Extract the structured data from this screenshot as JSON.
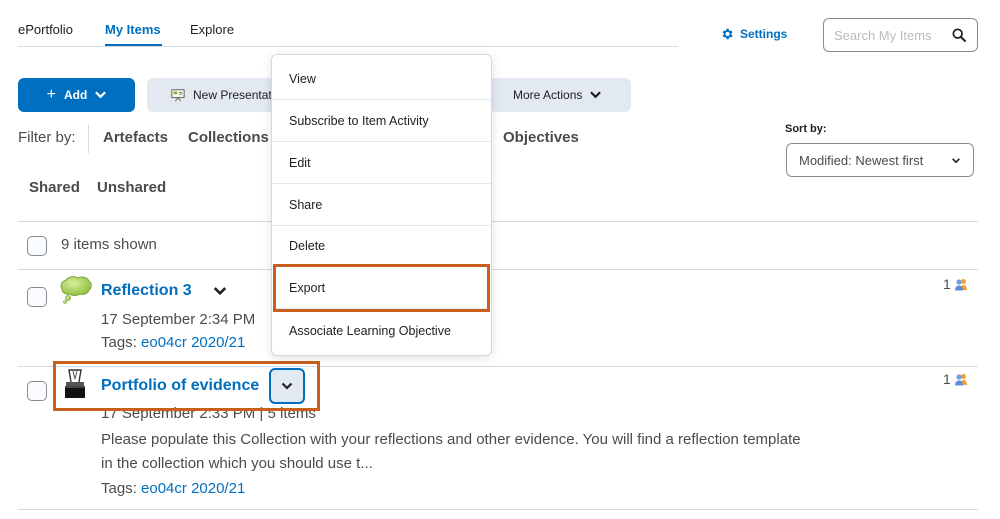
{
  "nav": {
    "tabs": [
      {
        "label": "ePortfolio",
        "active": false
      },
      {
        "label": "My Items",
        "active": true
      },
      {
        "label": "Explore",
        "active": false
      }
    ],
    "settings_label": "Settings",
    "search_placeholder": "Search My Items"
  },
  "toolbar": {
    "add_label": "Add",
    "new_presentation_label": "New Presentat",
    "more_actions_label": "More Actions"
  },
  "filters": {
    "label": "Filter by:",
    "row1": [
      "Artefacts",
      "Collections",
      "Objectives"
    ],
    "row2": [
      "Shared",
      "Unshared"
    ]
  },
  "sort": {
    "label": "Sort by:",
    "selected": "Modified: Newest first"
  },
  "list": {
    "items_shown": "9 items shown",
    "items": [
      {
        "title": "Reflection 3",
        "icon": "reflection-speech-bubble-icon",
        "meta": "17 September 2:34 PM",
        "tags_label": "Tags:",
        "tags": "eo04cr 2020/21",
        "share_count": "1"
      },
      {
        "title": "Portfolio of evidence",
        "icon": "binder-clip-collection-icon",
        "meta": "17 September 2:33 PM | 5 items",
        "description_line1": "Please populate this Collection with your reflections and other evidence. You will find a reflection template",
        "description_line2": "in the collection which you should use t...",
        "tags_label": "Tags:",
        "tags": "eo04cr 2020/21",
        "share_count": "1"
      }
    ]
  },
  "context_menu": {
    "items": [
      "View",
      "Subscribe to Item Activity",
      "Edit",
      "Share",
      "Delete",
      "Export",
      "Associate Learning Objective"
    ],
    "highlighted": "Export"
  },
  "colors": {
    "accent": "#006fbf",
    "highlight_box": "#c8601c",
    "button_grey": "#e3e9f1"
  }
}
